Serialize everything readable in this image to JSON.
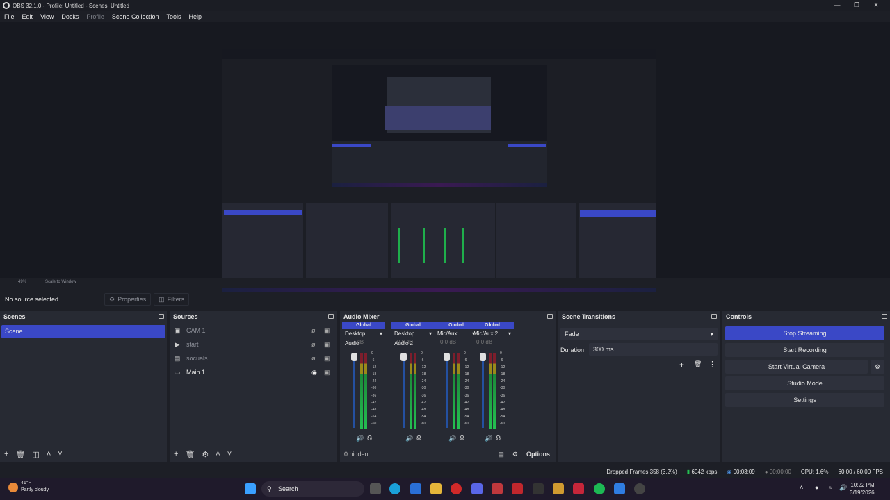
{
  "window": {
    "title": "OBS 32.1.0 - Profile: Untitled - Scenes: Untitled"
  },
  "menu": [
    "File",
    "Edit",
    "View",
    "Docks",
    "Profile",
    "Scene Collection",
    "Tools",
    "Help"
  ],
  "zoom_label": "49%",
  "scale_label": "Scale to Window",
  "source_bar": {
    "no_source": "No source selected",
    "properties": "Properties",
    "filters": "Filters"
  },
  "scenes": {
    "title": "Scenes",
    "items": [
      "Scene"
    ]
  },
  "sources": {
    "title": "Sources",
    "items": [
      {
        "name": "CAM 1",
        "visible": false
      },
      {
        "name": "start",
        "visible": false
      },
      {
        "name": "socuals",
        "visible": false
      },
      {
        "name": "Main 1",
        "visible": true
      }
    ]
  },
  "mixer": {
    "title": "Audio Mixer",
    "global": "Global",
    "channels": [
      {
        "name": "Desktop Audio",
        "db": "0.0 dB"
      },
      {
        "name": "Desktop Audio 2",
        "db": "0.0 dB"
      },
      {
        "name": "Mic/Aux",
        "db": "0.0 dB"
      },
      {
        "name": "Mic/Aux 2",
        "db": "0.0 dB"
      }
    ],
    "ticks": [
      "0",
      "-6",
      "-12",
      "-18",
      "-24",
      "-30",
      "-36",
      "-42",
      "-48",
      "-54",
      "-60"
    ],
    "hidden": "0 hidden",
    "options": "Options"
  },
  "transitions": {
    "title": "Scene Transitions",
    "selected": "Fade",
    "duration_label": "Duration",
    "duration_value": "300 ms"
  },
  "controls": {
    "title": "Controls",
    "buttons": [
      "Stop Streaming",
      "Start Recording",
      "Start Virtual Camera",
      "Studio Mode",
      "Settings"
    ]
  },
  "status": {
    "dropped": "Dropped Frames 358 (3.2%)",
    "kbps": "6042 kbps",
    "stream_time": "00:03:09",
    "rec_time": "00:00:00",
    "cpu": "CPU: 1.6%",
    "fps": "60.00 / 60.00 FPS"
  },
  "taskbar": {
    "temp": "41°F",
    "weather": "Partly cloudy",
    "search": "Search",
    "time": "10:22 PM",
    "date": "3/19/2026"
  },
  "colors": {
    "accent": "#3a48c6",
    "panel": "#272a33",
    "bg": "#1d1f26"
  }
}
